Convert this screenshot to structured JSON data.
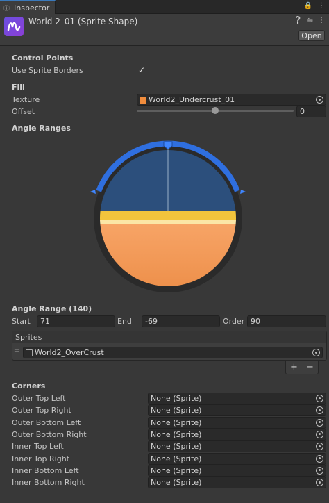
{
  "tab": {
    "label": "Inspector",
    "icon": "info-icon"
  },
  "tab_icons": [
    "lock-icon",
    "menu-dots-icon"
  ],
  "header": {
    "title": "World 2_01 (Sprite Shape)",
    "open_label": "Open",
    "icons": [
      "help-icon",
      "settings-sliders-icon",
      "menu-dots-icon"
    ]
  },
  "control_points": {
    "section": "Control Points",
    "use_sprite_borders_label": "Use Sprite Borders",
    "use_sprite_borders": true
  },
  "fill": {
    "section": "Fill",
    "texture_label": "Texture",
    "texture_value": "World2_Undercrust_01",
    "texture_color": "#f08c3c",
    "offset_label": "Offset",
    "offset_value": "0",
    "offset_fraction": 0.5
  },
  "angle_ranges": {
    "section": "Angle Ranges",
    "ring_color": "#2f6fe0",
    "top_color": "#2c4f7c",
    "bottom_color": "#f0904c"
  },
  "angle_range": {
    "section": "Angle Range (140)",
    "start_label": "Start",
    "start_value": "71",
    "end_label": "End",
    "end_value": "-69",
    "order_label": "Order",
    "order_value": "90",
    "sprites_header": "Sprites",
    "sprite_value": "World2_OverCrust",
    "plus": "+",
    "minus": "−"
  },
  "corners": {
    "section": "Corners",
    "items": [
      {
        "label": "Outer Top Left",
        "value": "None (Sprite)"
      },
      {
        "label": "Outer Top Right",
        "value": "None (Sprite)"
      },
      {
        "label": "Outer Bottom Left",
        "value": "None (Sprite)"
      },
      {
        "label": "Outer Bottom Right",
        "value": "None (Sprite)"
      },
      {
        "label": "Inner Top Left",
        "value": "None (Sprite)"
      },
      {
        "label": "Inner Top Right",
        "value": "None (Sprite)"
      },
      {
        "label": "Inner Bottom Left",
        "value": "None (Sprite)"
      },
      {
        "label": "Inner Bottom Right",
        "value": "None (Sprite)"
      }
    ]
  }
}
